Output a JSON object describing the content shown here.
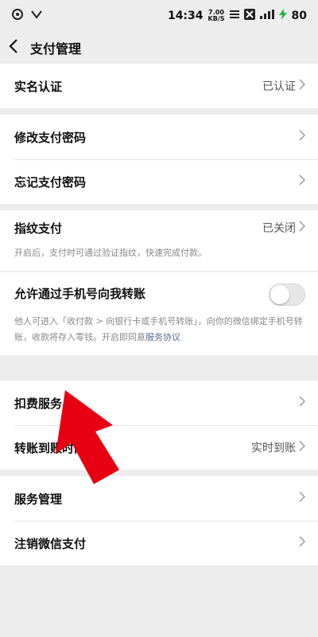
{
  "status_bar": {
    "time": "14:34",
    "speed_value": "7.00",
    "speed_unit": "KB/S",
    "battery": "80"
  },
  "nav": {
    "title": "支付管理"
  },
  "groups": {
    "realname": {
      "label": "实名认证",
      "value": "已认证"
    },
    "change_pwd": {
      "label": "修改支付密码"
    },
    "forgot_pwd": {
      "label": "忘记支付密码"
    },
    "fingerprint": {
      "label": "指纹支付",
      "value": "已关闭",
      "desc": "开启后，支付时可通过验证指纹，快速完成付款。"
    },
    "phone_transfer": {
      "label": "允许通过手机号向我转账",
      "desc": "他人可进入「收付款 > 向银行卡或手机号转账」，向你的微信绑定手机号转账，收款将存入零钱。开启即同意",
      "link": "服务协议"
    },
    "deduction": {
      "label": "扣费服务"
    },
    "transfer_time": {
      "label": "转账到账时间",
      "value": "实时到账"
    },
    "service_mgmt": {
      "label": "服务管理"
    },
    "cancel_pay": {
      "label": "注销微信支付"
    }
  },
  "colors": {
    "background": "#ededed",
    "card": "#ffffff",
    "link": "#576b95",
    "arrow": "#e60012"
  },
  "icons": {
    "back": "back-chevron-icon",
    "chevron": "chevron-right-icon"
  }
}
